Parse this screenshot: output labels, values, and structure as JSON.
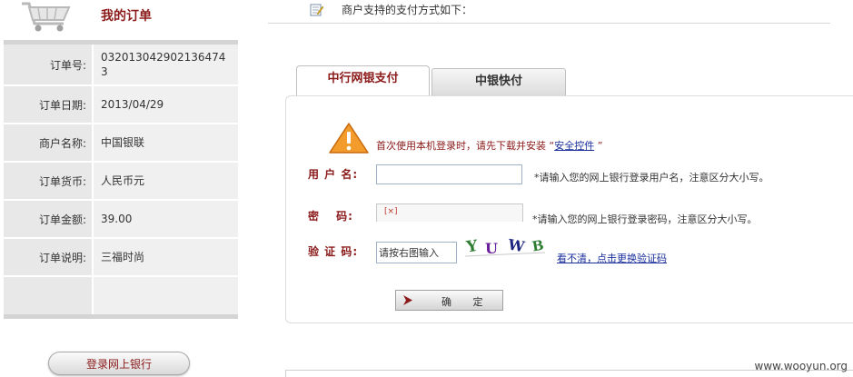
{
  "order": {
    "title": "我的订单",
    "rows": [
      {
        "label": "订单号:",
        "value": "032013042902136474 3"
      },
      {
        "label": "订单日期:",
        "value": "2013/04/29"
      },
      {
        "label": "商户名称:",
        "value": "中国银联"
      },
      {
        "label": "订单货币:",
        "value": "人民币元"
      },
      {
        "label": "订单金额:",
        "value": "39.00"
      },
      {
        "label": "订单说明:",
        "value": "三福时尚"
      },
      {
        "label": "",
        "value": ""
      }
    ],
    "login_button": "登录网上银行"
  },
  "payment": {
    "header": "商户支持的支付方式如下：",
    "tabs": [
      {
        "label": "中行网银支付",
        "active": true
      },
      {
        "label": "中银快付",
        "active": false
      }
    ],
    "warning_prefix": "首次使用本机登录时，请先下载并安装 “",
    "warning_link": "安全控件",
    "warning_suffix": " ”",
    "username_label": "用 户 名:",
    "username_value": "",
    "username_hint": "*请输入您的网上银行登录用户名，注意区分大小写。",
    "password_label": "密　 码:",
    "password_hint": "*请输入您的网上银行登录密码，注意区分大小写。",
    "captcha_label": "验 证 码:",
    "captcha_value": "请按右图输入",
    "captcha_text": "YUWB",
    "captcha_refresh": "看不清，点击更换验证码",
    "confirm_label": "确 定"
  },
  "watermark": "www.wooyun.org",
  "colors": {
    "accent": "#8b1a1a",
    "link": "#1a2f9c",
    "warning": "#f0a030"
  }
}
